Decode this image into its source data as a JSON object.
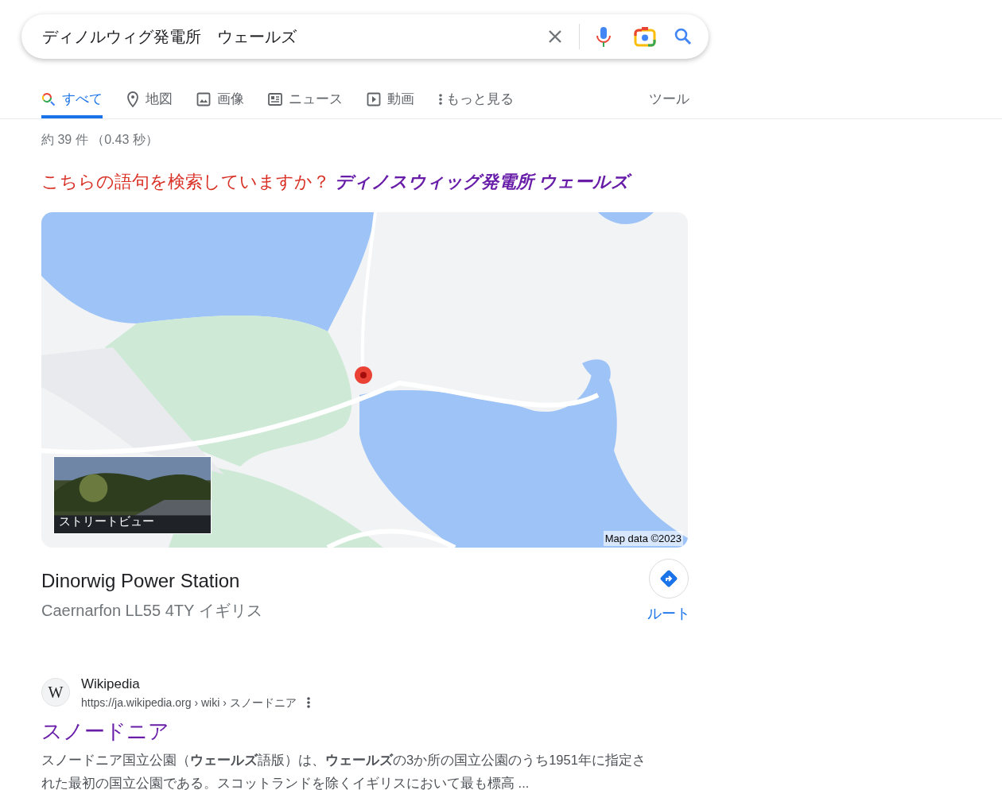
{
  "search": {
    "value": "ディノルウィグ発電所　ウェールズ"
  },
  "tabs": [
    {
      "kind": "all",
      "label": "すべて",
      "selected": true
    },
    {
      "kind": "maps",
      "label": "地図",
      "selected": false
    },
    {
      "kind": "images",
      "label": "画像",
      "selected": false
    },
    {
      "kind": "news",
      "label": "ニュース",
      "selected": false
    },
    {
      "kind": "videos",
      "label": "動画",
      "selected": false
    },
    {
      "kind": "more",
      "label": "もっと見る",
      "selected": false
    }
  ],
  "tools": "ツール",
  "result_stats": "約 39 件 （0.43 秒）",
  "did_you_mean": {
    "prompt": "こちらの語句を検索していますか？",
    "suggestion": "ディノスウィッグ発電所 ウェールズ"
  },
  "map": {
    "kind": "picture",
    "street_view_label": "ストリートビュー",
    "attribution": "Map data ©2023"
  },
  "place": {
    "name": "Dinorwig Power Station",
    "address": "Caernarfon LL55 4TY イギリス",
    "directions_label": "ルート"
  },
  "results": [
    {
      "site_name": "Wikipedia",
      "favicon_letter": "W",
      "url": "https://ja.wikipedia.org › wiki › スノードニア",
      "title": "スノードニア",
      "snippet": "スノードニア国立公園（**ウェールズ**語版）は、**ウェールズ**の3か所の国立公園のうち1951年に指定された最初の国立公園である。スコットランドを除くイギリスにおいて最も標高 ..."
    }
  ]
}
